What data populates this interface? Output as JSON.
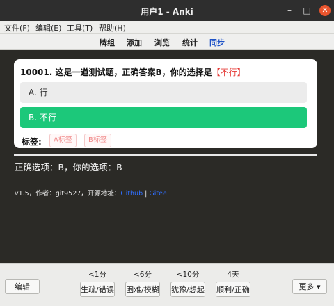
{
  "window": {
    "title": "用户1 - Anki"
  },
  "menu": [
    "文件(F)",
    "编辑(E)",
    "工具(T)",
    "帮助(H)"
  ],
  "toolbar": {
    "decks": "牌组",
    "add": "添加",
    "browse": "浏览",
    "stats": "统计",
    "sync": "同步"
  },
  "card": {
    "question": "10001. 这是一道测试题，正确答案B，你的选择是",
    "selected_mark": "【不行】",
    "options": [
      "A. 行",
      "B. 不行"
    ],
    "tags_label": "标签:",
    "tags": [
      "A标签",
      "B标签"
    ]
  },
  "answer_text": "正确选项：B，你的选项：B",
  "footer": {
    "prefix": "v1.5，作者：git9527，开源地址：",
    "link1": "Github",
    "sep": "|",
    "link2": "Gitee"
  },
  "bottom": {
    "edit_label": "编辑",
    "more_label": "更多 ▾",
    "ease": [
      {
        "time": "<1分",
        "label": "生疏/错误"
      },
      {
        "time": "<6分",
        "label": "困难/模糊"
      },
      {
        "time": "<10分",
        "label": "犹豫/想起"
      },
      {
        "time": "4天",
        "label": "顺利/正确"
      }
    ]
  },
  "colors": {
    "correct": "#1cc87a",
    "wrong": "#e53935",
    "link": "#2f6fff",
    "close_button": "#e9542d"
  }
}
